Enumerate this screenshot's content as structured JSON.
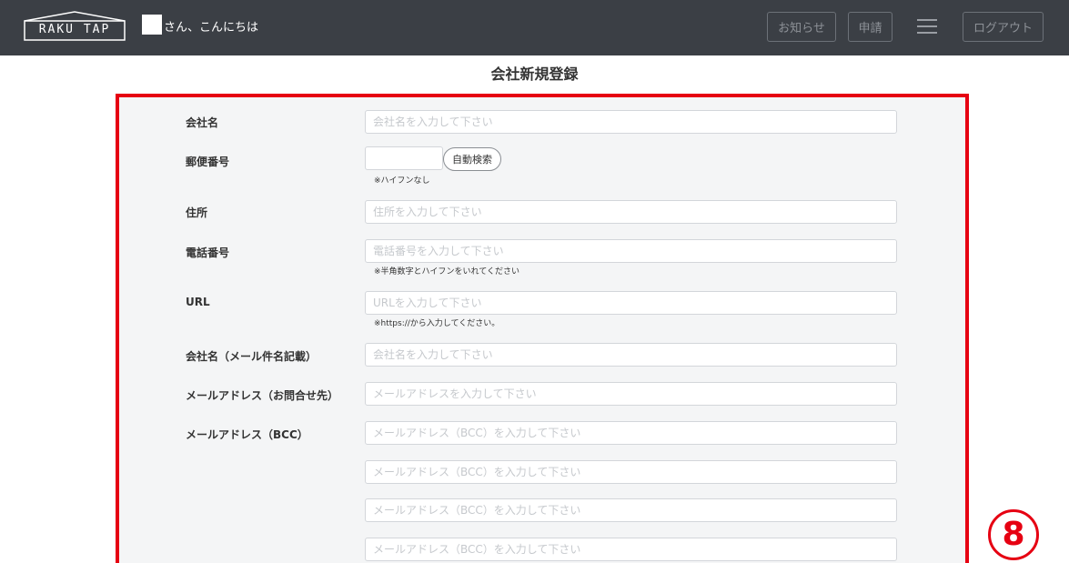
{
  "header": {
    "logo_text": "RAKU TAP",
    "greeting": "さん、こんにちは",
    "notice_label": "お知らせ",
    "apply_label": "申請",
    "logout_label": "ログアウト"
  },
  "page": {
    "title": "会社新規登録"
  },
  "form": {
    "company_name": {
      "label": "会社名",
      "placeholder": "会社名を入力して下さい"
    },
    "postal": {
      "label": "郵便番号",
      "button": "自動検索",
      "hint": "※ハイフンなし"
    },
    "address": {
      "label": "住所",
      "placeholder": "住所を入力して下さい"
    },
    "phone": {
      "label": "電話番号",
      "placeholder": "電話番号を入力して下さい",
      "hint": "※半角数字とハイフンをいれてください"
    },
    "url": {
      "label": "URL",
      "placeholder": "URLを入力して下さい",
      "hint": "※https://から入力してください。"
    },
    "mail_company": {
      "label": "会社名（メール件名記載）",
      "placeholder": "会社名を入力して下さい"
    },
    "email": {
      "label": "メールアドレス（お問合せ先）",
      "placeholder": "メールアドレスを入力して下さい"
    },
    "bcc": {
      "label": "メールアドレス（BCC）",
      "placeholders": [
        "メールアドレス（BCC）を入力して下さい",
        "メールアドレス（BCC）を入力して下さい",
        "メールアドレス（BCC）を入力して下さい",
        "メールアドレス（BCC）を入力して下さい"
      ]
    }
  },
  "annotation": {
    "step": "8"
  },
  "colors": {
    "topbar": "#3b3f45",
    "highlight": "#e60012",
    "form_bg": "#f4f5f6"
  }
}
